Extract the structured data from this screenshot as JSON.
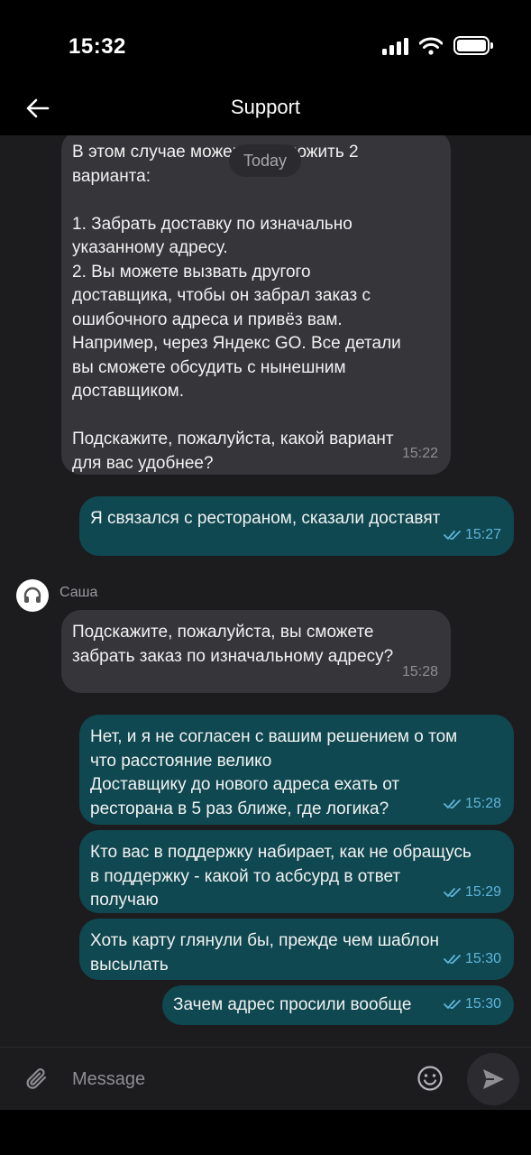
{
  "status_bar": {
    "time": "15:32"
  },
  "header": {
    "title": "Support"
  },
  "chat": {
    "date_label": "Today",
    "messages": [
      {
        "text": "В этом случае можем предложить 2\nварианта:\n\n1. Забрать доставку по изначально\nуказанному адресу.\n2. Вы можете вызвать другого\nдоставщика, чтобы он забрал заказ с\nошибочного адреса и привёз вам.\nНапример, через Яндекс GO. Все детали\nвы сможете обсудить с нынешним\nдоставщиком.\n\nПодскажите, пожалуйста, какой вариант\nдля вас удобнее?",
        "time": "15:22"
      },
      {
        "text": "Я связался с рестораном, сказали доставят",
        "time": "15:27"
      },
      {
        "sender": "Саша",
        "text": "Подскажите, пожалуйста, вы сможете\nзабрать заказ по изначальному адресу?",
        "time": "15:28"
      },
      {
        "text": "Нет, и я не согласен с вашим решением о том\nчто расстояние велико\nДоставщику до нового адреса ехать от\nресторана в 5 раз ближе, где логика?",
        "time": "15:28"
      },
      {
        "text": "Кто вас в поддержку набирает, как не обращусь\nв поддержку - какой то асбсурд в ответ\nполучаю",
        "time": "15:29"
      },
      {
        "text": "Хоть карту глянули бы, прежде чем шаблон\nвысылать",
        "time": "15:30"
      },
      {
        "text": "Зачем адрес просили вообще",
        "time": "15:30"
      }
    ]
  },
  "input_bar": {
    "placeholder": "Message"
  },
  "colors": {
    "incoming_bubble": "#35353a",
    "outgoing_bubble": "#0f4850",
    "read_ticks": "#5fb5dc"
  }
}
